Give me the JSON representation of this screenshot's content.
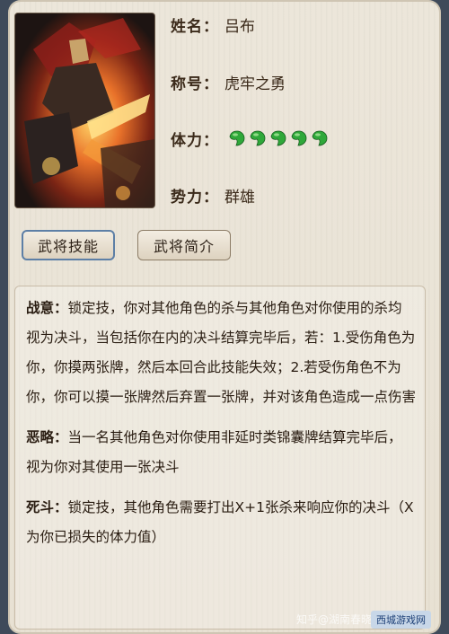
{
  "hero": {
    "name_label": "姓名：",
    "name": "吕布",
    "title_label": "称号：",
    "title": "虎牢之勇",
    "hp_label": "体力：",
    "hp_count": 5,
    "faction_label": "势力：",
    "faction": "群雄"
  },
  "tabs": [
    {
      "label": "武将技能",
      "active": true
    },
    {
      "label": "武将简介",
      "active": false
    }
  ],
  "skills": [
    {
      "name": "战意：",
      "text": "锁定技，你对其他角色的杀与其他角色对你使用的杀均视为决斗，当包括你在内的决斗结算完毕后，若：1.受伤角色为你，你摸两张牌，然后本回合此技能失效；2.若受伤角色不为你，你可以摸一张牌然后弃置一张牌，并对该角色造成一点伤害"
    },
    {
      "name": "恶略：",
      "text": "当一名其他角色对你使用非延时类锦囊牌结算完毕后，视为你对其使用一张决斗"
    },
    {
      "name": "死斗：",
      "text": "锁定技，其他角色需要打出X+1张杀来响应你的决斗（X为你已损失的体力值）"
    }
  ],
  "watermark": {
    "text": "知乎@湖南春晓",
    "logo": "西城游戏网"
  },
  "colors": {
    "hp": "#2fa83a",
    "accent_border": "#5d7fa6"
  }
}
